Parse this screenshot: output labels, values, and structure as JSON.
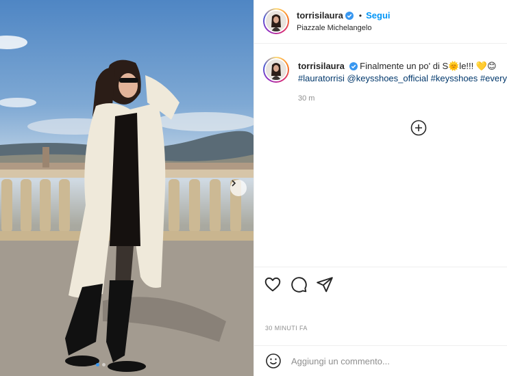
{
  "post": {
    "username": "torrisilaura",
    "verified": true,
    "follow_label": "Segui",
    "location": "Piazzale Michelangelo",
    "bullet": "•"
  },
  "caption": {
    "text": "Finalmente un po' di S🌞le!!! 💛😊",
    "hashtags": [
      "#lauratorrisi",
      "@keysshoes_official",
      "#keysshoes",
      "#everyday"
    ],
    "time_ago": "30 m"
  },
  "actions": {
    "like_icon": "heart-icon",
    "comment_icon": "comment-icon",
    "share_icon": "paper-plane-icon",
    "posted_ago": "30 MINUTI FA"
  },
  "comment_box": {
    "placeholder": "Aggiungi un commento...",
    "emoji_icon": "smiley-icon"
  },
  "carousel": {
    "total": 2,
    "current": 1
  },
  "colors": {
    "accent": "#0095f6",
    "verified": "#3897f0",
    "link": "#00376b",
    "muted": "#8e8e8e"
  }
}
